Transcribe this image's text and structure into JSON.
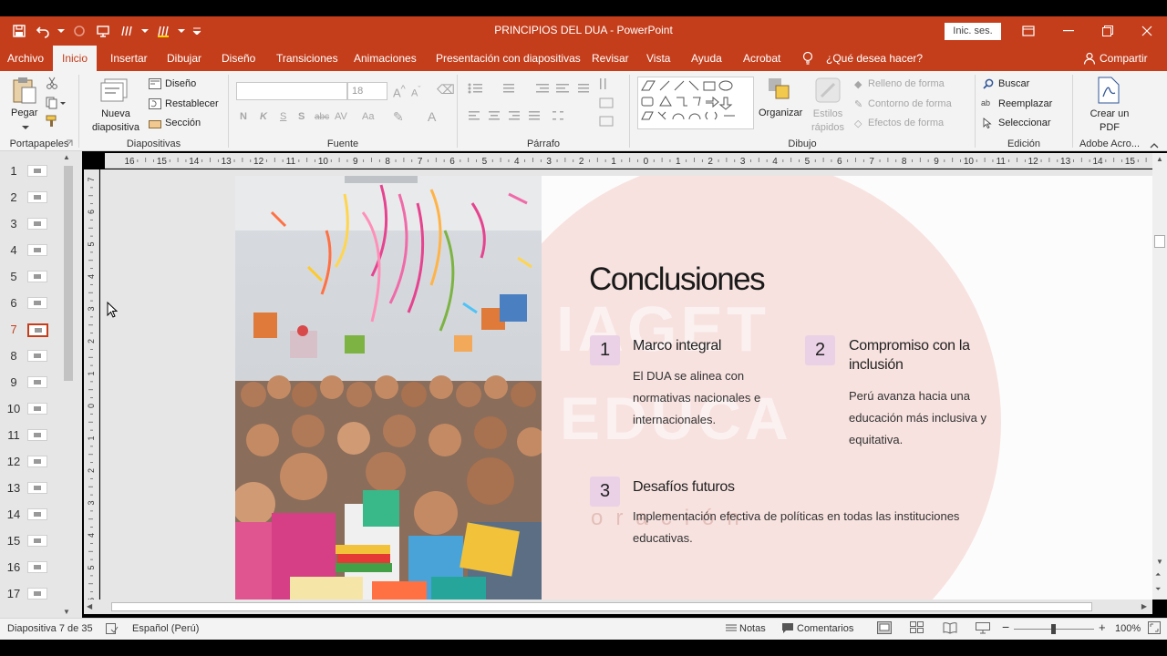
{
  "window": {
    "title": "PRINCIPIOS DEL DUA  -  PowerPoint",
    "signin_label": "Inic. ses."
  },
  "tabs": [
    {
      "label": "Archivo"
    },
    {
      "label": "Inicio"
    },
    {
      "label": "Insertar"
    },
    {
      "label": "Dibujar"
    },
    {
      "label": "Diseño"
    },
    {
      "label": "Transiciones"
    },
    {
      "label": "Animaciones"
    },
    {
      "label": "Presentación con diapositivas"
    },
    {
      "label": "Revisar"
    },
    {
      "label": "Vista"
    },
    {
      "label": "Ayuda"
    },
    {
      "label": "Acrobat"
    },
    {
      "label": "¿Qué desea hacer?"
    },
    {
      "label": "Compartir"
    }
  ],
  "ribbon": {
    "clipboard": {
      "paste_label": "Pegar",
      "group_label": "Portapapeles"
    },
    "slides": {
      "new_slide_label": "Nueva diapositiva",
      "layout_label": "Diseño",
      "reset_label": "Restablecer",
      "section_label": "Sección",
      "group_label": "Diapositivas"
    },
    "font": {
      "font_name_value": "",
      "font_size_value": "18",
      "format_buttons": [
        "N",
        "K",
        "S",
        "S",
        "abc",
        "AV",
        "Aa"
      ],
      "group_label": "Fuente"
    },
    "paragraph": {
      "group_label": "Párrafo"
    },
    "drawing": {
      "arrange_label": "Organizar",
      "quick_styles_label": "Estilos rápidos",
      "shape_fill_label": "Relleno de forma",
      "shape_outline_label": "Contorno de forma",
      "shape_effects_label": "Efectos de forma",
      "group_label": "Dibujo"
    },
    "editing": {
      "find_label": "Buscar",
      "replace_label": "Reemplazar",
      "select_label": "Seleccionar",
      "group_label": "Edición"
    },
    "adobe": {
      "create_pdf_label": "Crear un PDF",
      "group_label": "Adobe Acro..."
    }
  },
  "thumbnails": [
    {
      "num": "1"
    },
    {
      "num": "2"
    },
    {
      "num": "3"
    },
    {
      "num": "4"
    },
    {
      "num": "5"
    },
    {
      "num": "6"
    },
    {
      "num": "7"
    },
    {
      "num": "8"
    },
    {
      "num": "9"
    },
    {
      "num": "10"
    },
    {
      "num": "11"
    },
    {
      "num": "12"
    },
    {
      "num": "13"
    },
    {
      "num": "14"
    },
    {
      "num": "15"
    },
    {
      "num": "16"
    },
    {
      "num": "17"
    }
  ],
  "selected_slide": 7,
  "ruler": {
    "h_ticks": [
      "16",
      "15",
      "14",
      "13",
      "12",
      "11",
      "10",
      "9",
      "8",
      "7",
      "6",
      "5",
      "4",
      "3",
      "2",
      "1",
      "0",
      "1",
      "2",
      "3",
      "4",
      "5",
      "6",
      "7",
      "8",
      "9",
      "10",
      "11",
      "12",
      "13",
      "14",
      "15"
    ],
    "v_ticks": [
      "7",
      "6",
      "5",
      "4",
      "3",
      "2",
      "1",
      "0",
      "1",
      "2",
      "3",
      "4",
      "5",
      "6",
      "7"
    ]
  },
  "slide": {
    "title": "Conclusiones",
    "watermark_line1": "IAGET",
    "watermark_line2": "EDUCA",
    "watermark_line3": "oración",
    "items": [
      {
        "num": "1",
        "heading": "Marco integral",
        "body": "El DUA se alinea con normativas nacionales e internacionales."
      },
      {
        "num": "2",
        "heading": "Compromiso con la inclusión",
        "body": "Perú avanza hacia una educación más inclusiva y equitativa."
      },
      {
        "num": "3",
        "heading": "Desafíos futuros",
        "body": "Implementación efectiva de políticas en todas las instituciones educativas."
      }
    ]
  },
  "status": {
    "slide_counter": "Diapositiva 7 de 35",
    "language": "Español (Perú)",
    "notes_label": "Notas",
    "comments_label": "Comentarios",
    "zoom_value": "100%"
  },
  "colors": {
    "accent": "#c43e1c",
    "badge": "#ead1e6"
  }
}
